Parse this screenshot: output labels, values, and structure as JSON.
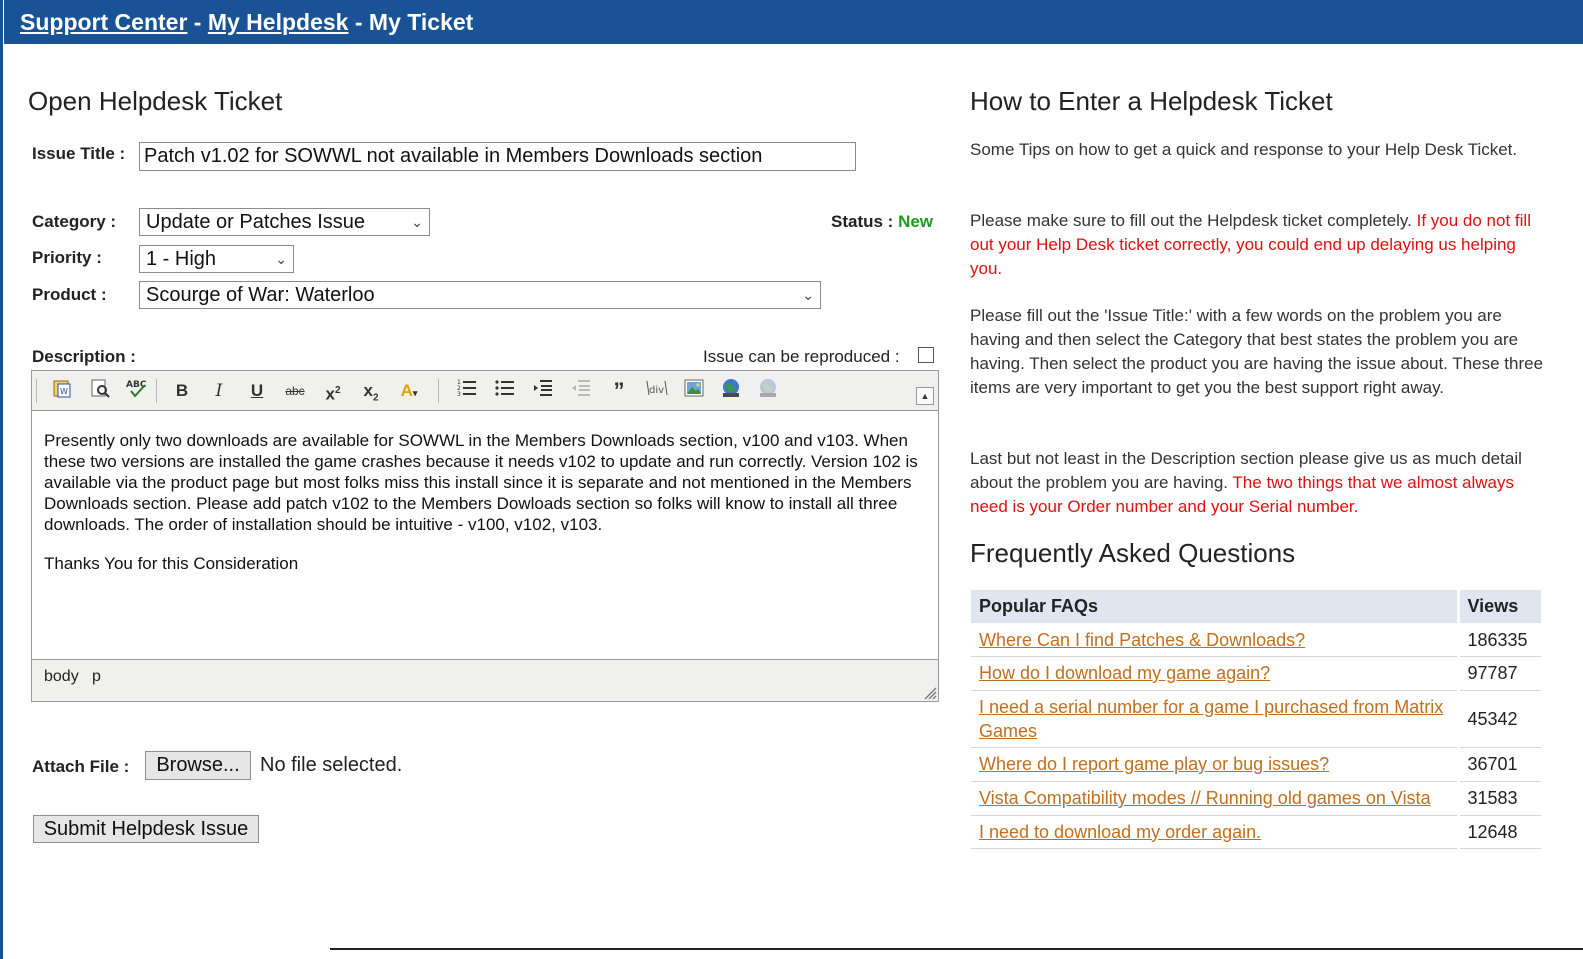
{
  "header": {
    "crumb_support": "Support Center",
    "sep1": " - ",
    "crumb_helpdesk": "My Helpdesk",
    "sep2": " - ",
    "crumb_current": "My Ticket",
    "color": "#1a5296"
  },
  "form": {
    "title": "Open Helpdesk Ticket",
    "issue_title_label": "Issue Title :",
    "issue_title_value": "Patch v1.02 for SOWWL not available in Members Downloads section",
    "category_label": "Category :",
    "category_value": "Update or Patches Issue",
    "status_label": "Status : ",
    "status_value": "New",
    "priority_label": "Priority :",
    "priority_value": "1 - High",
    "product_label": "Product :",
    "product_value": "Scourge of War: Waterloo",
    "description_label": "Description :",
    "reproduced_label": "Issue can be reproduced :",
    "reproduced_checked": false,
    "description_paragraphs": [
      "Presently only two downloads are available for SOWWL in the Members Downloads section, v100 and v103. When these two versions are installed the game crashes because it needs v102 to update and run correctly. Version 102 is available via the product page but most folks miss this install since it is separate and not mentioned in the Members Downloads section.  Please add patch v102 to the Members Dowloads section so folks will know to install all three downloads.  The order of installation should be intuitive - v100,  v102, v103.",
      "Thanks You for this Consideration"
    ],
    "editor_path": [
      "body",
      "p"
    ],
    "toolbar_icons": [
      "paste-word-icon",
      "preview-icon",
      "spellcheck-icon",
      "bold-icon",
      "italic-icon",
      "underline-icon",
      "strikethrough-icon",
      "superscript-icon",
      "subscript-icon",
      "font-color-icon",
      "ordered-list-icon",
      "unordered-list-icon",
      "indent-icon",
      "outdent-icon",
      "blockquote-icon",
      "insert-div-icon",
      "insert-image-icon",
      "insert-link-icon",
      "remove-link-icon"
    ],
    "attach_label": "Attach File :",
    "browse_label": "Browse...",
    "no_file_text": "No file selected.",
    "submit_label": "Submit Helpdesk Issue"
  },
  "help": {
    "title": "How to Enter a Helpdesk Ticket",
    "p1": "Some Tips on how to get a quick and response to your Help Desk Ticket.",
    "p2_normal": "Please make sure to fill out the Helpdesk ticket completely. ",
    "p2_red": "If you do not fill out your Help Desk ticket correctly, you could end up delaying us helping you.",
    "p3": "Please fill out the 'Issue Title:' with a few words on the problem you are having and then select the Category that best states the problem you are having. Then select the product you are having the issue about. These three items are very important to get you the best support right away.",
    "p4_normal": "Last but not least in the Description section please give us as much detail about the problem you are having. ",
    "p4_red": "The two things that we almost always need is your Order number and your Serial number.",
    "red_color": "#e01010"
  },
  "faq": {
    "title": "Frequently Asked Questions",
    "col_faq": "Popular FAQs",
    "col_views": "Views",
    "rows": [
      {
        "question": "Where Can I find Patches & Downloads?",
        "views": "186335"
      },
      {
        "question": "How do I download my game again?",
        "views": "97787"
      },
      {
        "question": "I need a serial number for a game I purchased from Matrix Games",
        "views": "45342"
      },
      {
        "question": "Where do I report game play or bug issues?",
        "views": "36701"
      },
      {
        "question": "Vista Compatibility modes // Running old games on Vista",
        "views": "31583"
      },
      {
        "question": "I need to download my order again.",
        "views": "12648"
      }
    ],
    "link_color": "#c0701e"
  }
}
